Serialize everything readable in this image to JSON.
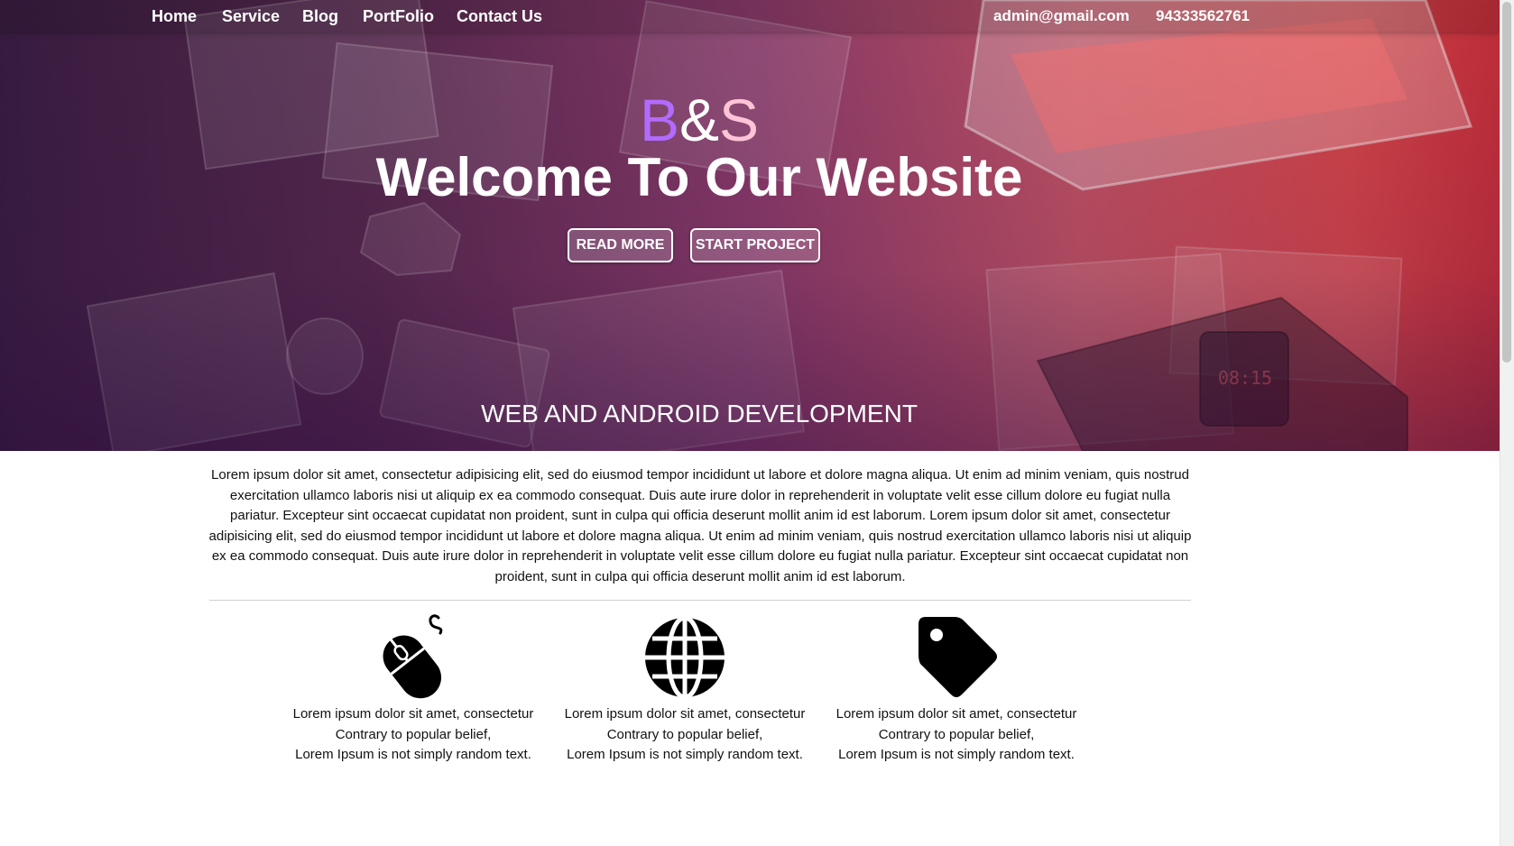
{
  "nav": {
    "items": [
      "Home",
      "Service",
      "Blog",
      "PortFolio",
      "Contact Us"
    ],
    "email": "admin@gmail.com",
    "phone": "94333562761"
  },
  "hero": {
    "logo_b": "B",
    "logo_amp": "&",
    "logo_s": "S",
    "headline": "Welcome To Our Website",
    "read_more": "READ MORE",
    "start_project": "START PROJECT",
    "tagline": "WEB AND ANDROID DEVELOPMENT"
  },
  "intro": "Lorem ipsum dolor sit amet, consectetur adipisicing elit, sed do eiusmod tempor incididunt ut labore et dolore magna aliqua. Ut enim ad minim veniam, quis nostrud exercitation ullamco laboris nisi ut aliquip ex ea commodo consequat. Duis aute irure dolor in reprehenderit in voluptate velit esse cillum dolore eu fugiat nulla pariatur. Excepteur sint occaecat cupidatat non proident, sunt in culpa qui officia deserunt mollit anim id est laborum. Lorem ipsum dolor sit amet, consectetur adipisicing elit, sed do eiusmod tempor incididunt ut labore et dolore magna aliqua. Ut enim ad minim veniam, quis nostrud exercitation ullamco laboris nisi ut aliquip ex ea commodo consequat. Duis aute irure dolor in reprehenderit in voluptate velit esse cillum dolore eu fugiat nulla pariatur. Excepteur sint occaecat cupidatat non proident, sunt in culpa qui officia deserunt mollit anim id est laborum.",
  "features": [
    {
      "icon": "mouse-icon",
      "line1": "Lorem ipsum dolor sit amet, consectetur",
      "line2": "Contrary to popular belief,",
      "line3": "Lorem Ipsum is not simply random text."
    },
    {
      "icon": "globe-icon",
      "line1": "Lorem ipsum dolor sit amet, consectetur",
      "line2": "Contrary to popular belief,",
      "line3": "Lorem Ipsum is not simply random text."
    },
    {
      "icon": "tag-icon",
      "line1": "Lorem ipsum dolor sit amet, consectetur",
      "line2": "Contrary to popular belief,",
      "line3": "Lorem Ipsum is not simply random text."
    }
  ],
  "colors": {
    "logo_b": "#b26bff",
    "logo_s": "#ffc4d6",
    "hero_left": "#3a1d42",
    "hero_right": "#c8303c"
  }
}
